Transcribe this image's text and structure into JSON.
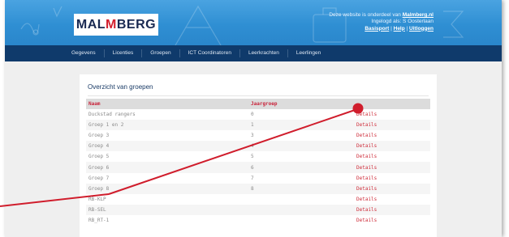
{
  "brand": {
    "logo_left": "MAL",
    "logo_accent": "M",
    "logo_right": "BERG"
  },
  "header_info": {
    "line1_prefix": "Deze website is onderdeel van ",
    "line1_link": "Malmberg.nl",
    "line2": "Ingelogd als: S Oosterlaan",
    "basisport": "Basisport",
    "sep1": " | ",
    "help": "Help",
    "sep2": " | ",
    "logout": "Uitloggen"
  },
  "nav": [
    "Gegevens",
    "Licenties",
    "Groepen",
    "ICT Coordinatoren",
    "Leerkrachten",
    "Leerlingen"
  ],
  "panel_title": "Overzicht van groepen",
  "table": {
    "headers": [
      "Naam",
      "Jaargroep",
      ""
    ],
    "rows": [
      [
        "Duckstad rangers",
        "0",
        "Details"
      ],
      [
        "Groep 1 en 2",
        "1",
        "Details"
      ],
      [
        "Groep 3",
        "3",
        "Details"
      ],
      [
        "Groep 4",
        "4",
        "Details"
      ],
      [
        "Groep 5",
        "5",
        "Details"
      ],
      [
        "Groep 6",
        "6",
        "Details"
      ],
      [
        "Groep 7",
        "7",
        "Details"
      ],
      [
        "Groep 8",
        "8",
        "Details"
      ],
      [
        "RB-KLP",
        "",
        "Details"
      ],
      [
        "RB-SEL",
        "",
        "Details"
      ],
      [
        "RB_RT-1",
        "",
        "Details"
      ]
    ]
  },
  "colors": {
    "header_blue": "#3598db",
    "nav_dark": "#0f3a6b",
    "accent_red": "#cf2f3c",
    "annotation_red": "#d01d2c"
  }
}
